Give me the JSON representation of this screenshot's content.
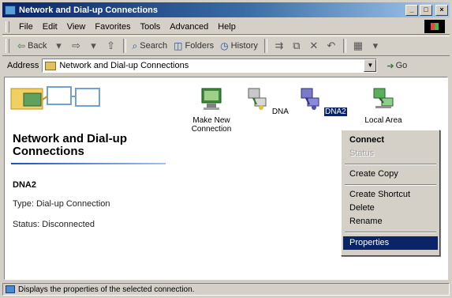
{
  "window": {
    "title": "Network and Dial-up Connections",
    "controls": {
      "minimize": "_",
      "maximize": "□",
      "close": "×"
    }
  },
  "menubar": {
    "items": [
      "File",
      "Edit",
      "View",
      "Favorites",
      "Tools",
      "Advanced",
      "Help"
    ]
  },
  "toolbar": {
    "back": "Back",
    "back_glyph": "⇦",
    "forward_glyph": "⇨",
    "dropdown_glyph": "▾",
    "up_glyph": "⇧",
    "search": "Search",
    "search_glyph": "⌕",
    "folders": "Folders",
    "folders_glyph": "◫",
    "history": "History",
    "history_glyph": "◷",
    "move_glyph": "⇉",
    "copy_glyph": "⧉",
    "delete_glyph": "✕",
    "undo_glyph": "↶",
    "views_glyph": "▦"
  },
  "addressbar": {
    "label": "Address",
    "value": "Network and Dial-up Connections",
    "dropdown_glyph": "▼",
    "go_label": "Go",
    "go_glyph": "➔"
  },
  "leftpanel": {
    "title_line1": "Network and Dial-up",
    "title_line2": "Connections",
    "selected_name": "DNA2",
    "selected_type": "Type: Dial-up Connection",
    "selected_status": "Status: Disconnected"
  },
  "icons": [
    {
      "name": "make-new-connection",
      "label_line1": "Make New",
      "label_line2": "Connection",
      "icon": "make-new-connection-icon"
    },
    {
      "name": "dna",
      "label_line1": "DNA",
      "label_line2": "",
      "icon": "dialup-connection-icon"
    },
    {
      "name": "dna2",
      "label_line1": "DNA2",
      "label_line2": "",
      "icon": "dialup-connection-icon",
      "selected": true
    },
    {
      "name": "local-area",
      "label_line1": "Local Area",
      "label_line2": "",
      "icon": "lan-connection-icon"
    }
  ],
  "context_menu": {
    "items": {
      "connect": "Connect",
      "status": "Status",
      "create_copy": "Create Copy",
      "create_shortcut": "Create Shortcut",
      "delete": "Delete",
      "rename": "Rename",
      "properties": "Properties"
    }
  },
  "statusbar": {
    "text": "Displays the properties of the selected connection."
  },
  "colors": {
    "title_bar": "#0a246a",
    "selection": "#0a246a",
    "chrome": "#d4d0c8"
  }
}
